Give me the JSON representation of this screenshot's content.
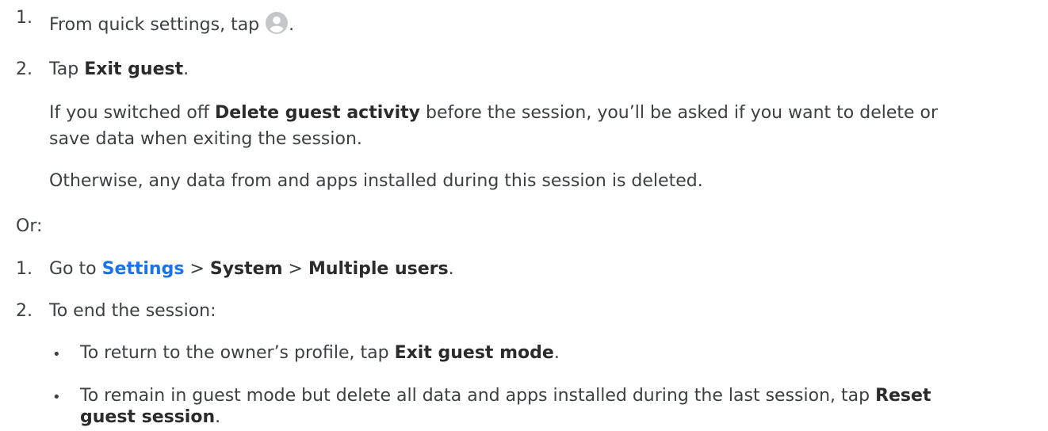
{
  "steps_a": {
    "step1": {
      "num": "1.",
      "text_before": "From quick settings, tap ",
      "text_after": ".",
      "icon": "account-circle-icon"
    },
    "step2": {
      "num": "2.",
      "text": "Tap ",
      "bold": "Exit guest",
      "end": "."
    },
    "para1": {
      "prefix": "If you switched off ",
      "bold": "Delete guest activity",
      "suffix1": " before the session, you’ll be asked if you want to delete or",
      "line2": "save data when exiting the session."
    },
    "para2": "Otherwise, any data from and apps installed during this session is deleted."
  },
  "or_label": "Or:",
  "steps_b": {
    "step1": {
      "num": "1.",
      "prefix": "Go to ",
      "link": "Settings",
      "sep1": " > ",
      "bold1": "System",
      "sep2": " > ",
      "bold2": "Multiple users",
      "end": "."
    },
    "step2": {
      "num": "2.",
      "text": "To end the session:"
    },
    "bullets": [
      {
        "bullet": "•",
        "prefix": "To return to the owner’s profile, tap ",
        "bold": "Exit guest mode",
        "end": "."
      },
      {
        "bullet": "•",
        "prefix": "To remain in guest mode but delete all data and apps installed during the last session, tap ",
        "bold": "Reset",
        "line2_bold": "guest session",
        "end": "."
      }
    ]
  },
  "colors": {
    "text": "#3c4043",
    "link": "#1a73e8",
    "icon_bg": "#c4c7c9"
  }
}
